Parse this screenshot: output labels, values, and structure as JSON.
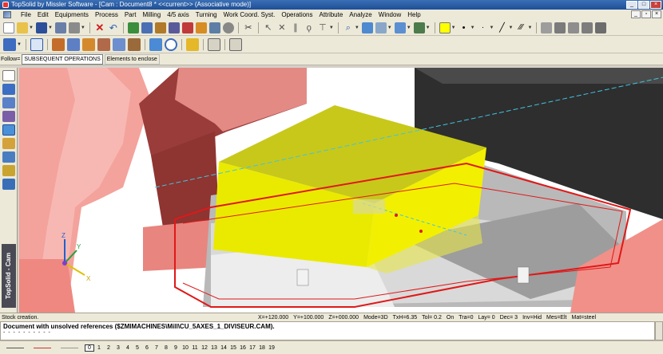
{
  "window": {
    "title": "TopSolid by Missler Software - [Cam : Document8 *  <<current>> (Associative mode)]",
    "buttons": [
      "minimize",
      "maximize",
      "close"
    ]
  },
  "menu": {
    "items": [
      "File",
      "Edit",
      "Equipments",
      "Process",
      "Part",
      "Milling",
      "4/5 axis",
      "Turning",
      "Work Coord. Syst.",
      "Operations",
      "Attribute",
      "Analyze",
      "Window",
      "Help"
    ]
  },
  "follow_bar": {
    "label": "Follow=",
    "option": "SUBSEQUENT OPERATIONS",
    "action": "Elements to enclose"
  },
  "sidebar": {
    "vertical_label": "TopSolid - Cam"
  },
  "status": {
    "message": "Stock creation.",
    "x": "X=+120.000",
    "y": "Y=+100.000",
    "z": "Z=+000.000",
    "mode": "Mode=3D",
    "txh": "TxH=6.35",
    "tol": "Tol=  0.2",
    "on": "On",
    "tra": "Tra=0",
    "lay": "Lay=  0",
    "dec": "Dec= 3",
    "inv": "Inv=Hid",
    "mes": "Mes=Elt",
    "mat": "Mat=steel"
  },
  "document_message": {
    "line1": "Document with unsolved references ($ZMIMACHINES\\Mill\\CU_5AXES_1_DIVISEUR.CAM).",
    "line2": "- - - - - - - - - -"
  },
  "layers": {
    "active": "0",
    "items": [
      "0",
      "1",
      "2",
      "3",
      "4",
      "5",
      "6",
      "7",
      "8",
      "9",
      "10",
      "11",
      "12",
      "13",
      "14",
      "15",
      "16",
      "17",
      "18",
      "19"
    ]
  },
  "axes": {
    "x": "X",
    "y": "Y",
    "z": "Z"
  },
  "colors": {
    "stock_yellow": "#eaea00",
    "machine_pink": "#f0908a",
    "stock_outline": "#e01818"
  }
}
